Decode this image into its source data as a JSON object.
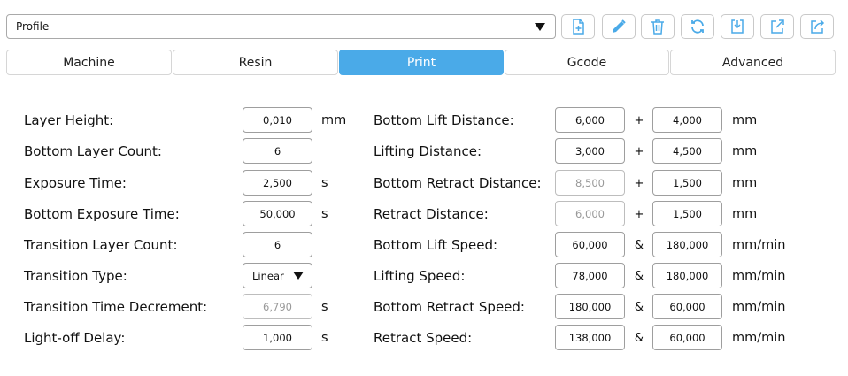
{
  "profile": {
    "value": "Profile"
  },
  "toolbar": {
    "buttons": [
      "new-profile",
      "edit-profile",
      "delete-profile",
      "refresh-profiles",
      "import-profile",
      "export-profile",
      "export-profile-to-printer"
    ],
    "icon_color": "#4aaae8"
  },
  "tabs": [
    {
      "label": "Machine",
      "active": false
    },
    {
      "label": "Resin",
      "active": false
    },
    {
      "label": "Print",
      "active": true
    },
    {
      "label": "Gcode",
      "active": false
    },
    {
      "label": "Advanced",
      "active": false
    }
  ],
  "left": [
    {
      "label": "Layer Height:",
      "value": "0,010",
      "unit": "mm"
    },
    {
      "label": "Bottom Layer Count:",
      "value": "6",
      "unit": ""
    },
    {
      "label": "Exposure Time:",
      "value": "2,500",
      "unit": "s"
    },
    {
      "label": "Bottom Exposure Time:",
      "value": "50,000",
      "unit": "s"
    },
    {
      "label": "Transition Layer Count:",
      "value": "6",
      "unit": ""
    },
    {
      "label": "Transition Type:",
      "value": "Linear",
      "unit": ""
    },
    {
      "label": "Transition Time Decrement:",
      "value": "6,790",
      "unit": "s"
    },
    {
      "label": "Light-off Delay:",
      "value": "1,000",
      "unit": "s"
    }
  ],
  "right": [
    {
      "label": "Bottom Lift Distance:",
      "value1": "6,000",
      "op": "+",
      "value2": "4,000",
      "unit": "mm"
    },
    {
      "label": "Lifting Distance:",
      "value1": "3,000",
      "op": "+",
      "value2": "4,500",
      "unit": "mm"
    },
    {
      "label": "Bottom Retract Distance:",
      "value1": "8,500",
      "op": "+",
      "value2": "1,500",
      "unit": "mm"
    },
    {
      "label": "Retract Distance:",
      "value1": "6,000",
      "op": "+",
      "value2": "1,500",
      "unit": "mm"
    },
    {
      "label": "Bottom Lift Speed:",
      "value1": "60,000",
      "op": "&",
      "value2": "180,000",
      "unit": "mm/min"
    },
    {
      "label": "Lifting Speed:",
      "value1": "78,000",
      "op": "&",
      "value2": "180,000",
      "unit": "mm/min"
    },
    {
      "label": "Bottom Retract Speed:",
      "value1": "180,000",
      "op": "&",
      "value2": "60,000",
      "unit": "mm/min"
    },
    {
      "label": "Retract Speed:",
      "value1": "138,000",
      "op": "&",
      "value2": "60,000",
      "unit": "mm/min"
    }
  ]
}
